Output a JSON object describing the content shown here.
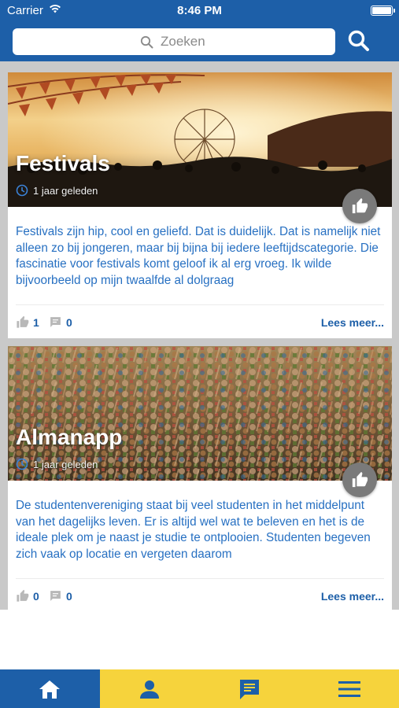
{
  "status_bar": {
    "carrier": "Carrier",
    "time": "8:46 PM"
  },
  "search": {
    "placeholder": "Zoeken",
    "value": ""
  },
  "articles": [
    {
      "title": "Festivals",
      "time": "1 jaar geleden",
      "excerpt": "Festivals zijn hip, cool en geliefd. Dat is duidelijk. Dat is namelijk niet alleen zo bij jongeren, maar bij bijna bij iedere leeftijdscategorie. Die fascinatie voor festivals komt geloof ik al erg vroeg. Ik wilde bijvoorbeeld op mijn twaalfde al dolgraag",
      "likes": "1",
      "comments": "0",
      "more_label": "Lees meer..."
    },
    {
      "title": "Almanapp",
      "time": "1 jaar geleden",
      "excerpt": "De studentenvereniging staat bij veel studenten in het middelpunt van het dagelijks leven. Er is altijd wel wat te beleven en het is de ideale plek om je naast je studie te ontplooien. Studenten begeven zich vaak op locatie en vergeten daarom",
      "likes": "0",
      "comments": "0",
      "more_label": "Lees meer..."
    }
  ],
  "tabs": [
    {
      "icon": "home-icon",
      "active": true
    },
    {
      "icon": "person-icon",
      "active": false
    },
    {
      "icon": "chat-icon",
      "active": false
    },
    {
      "icon": "menu-icon",
      "active": false
    }
  ],
  "colors": {
    "primary": "#1d5fa8",
    "accent": "#f6d33c",
    "text_blue": "#2770c2",
    "background_gray": "#c9c9c9"
  }
}
